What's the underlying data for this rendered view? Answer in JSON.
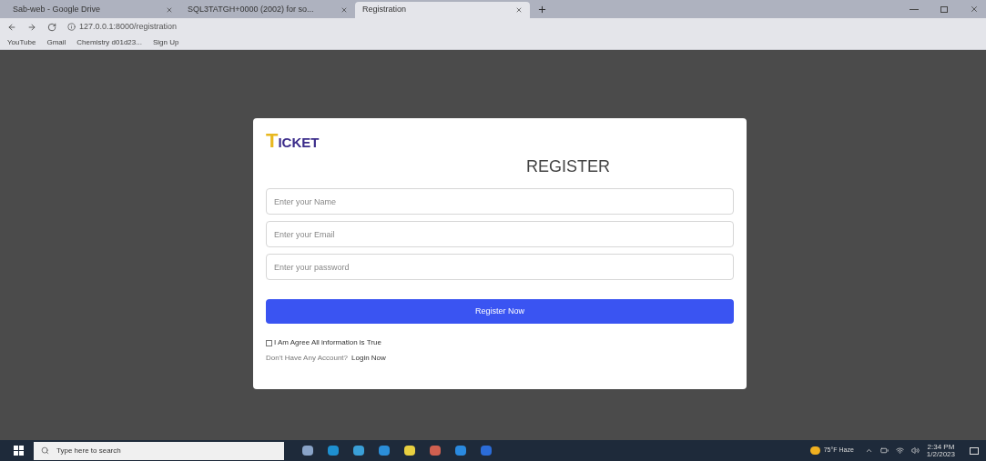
{
  "tabs": [
    {
      "title": "Sab-web - Google Drive",
      "selected": false
    },
    {
      "title": "SQL3TATGH+0000 (2002) for so...",
      "selected": false
    },
    {
      "title": "Registration",
      "selected": true
    }
  ],
  "address_bar": {
    "url": "127.0.0.1:8000/registration"
  },
  "bookmarks": [
    "YouTube",
    "Gmail",
    "Chemistry d01d23...",
    "Sign Up"
  ],
  "form": {
    "logo_initial": "T",
    "logo_rest": "ICKET",
    "heading": "REGISTER",
    "fields": [
      {
        "placeholder": "Enter your Name"
      },
      {
        "placeholder": "Enter your Email"
      },
      {
        "placeholder": "Enter your password"
      }
    ],
    "submit": "Register Now",
    "agree": {
      "label": "I Am Agree All information is True",
      "checked": false
    },
    "login_prompt": "Don't Have Any Account?",
    "login_link": "Login Now"
  },
  "taskbar": {
    "search_placeholder": "Type here to search",
    "weather": "75°F Haze",
    "time": "2:34 PM",
    "date": "1/2/2023"
  }
}
